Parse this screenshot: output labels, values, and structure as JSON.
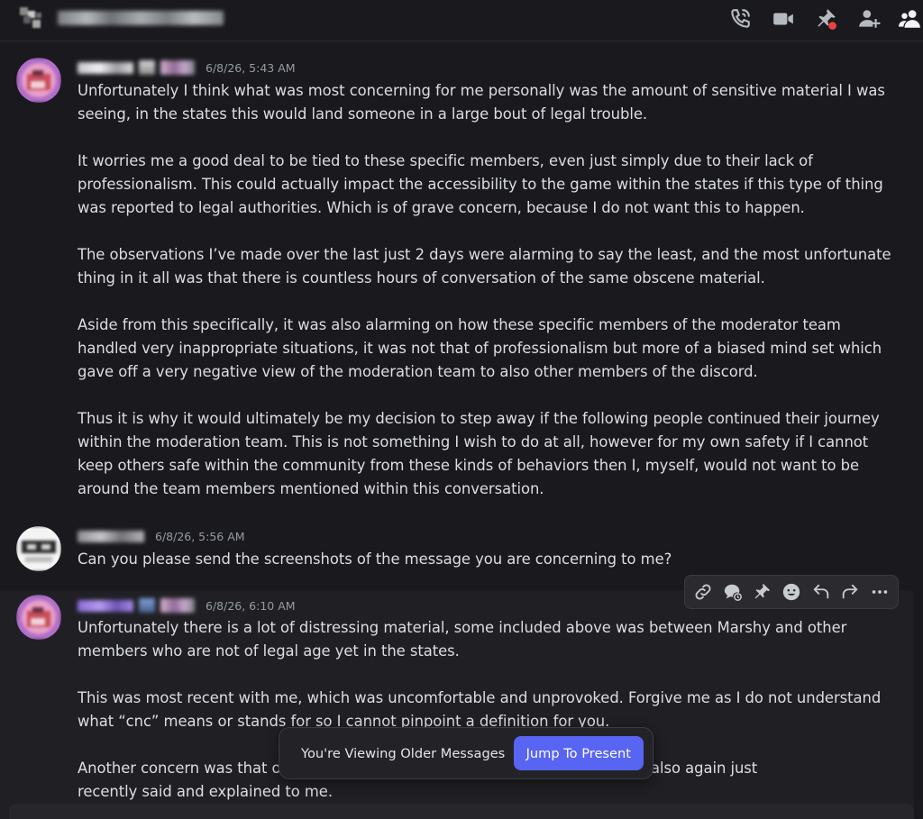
{
  "header": {
    "title": "C1Gamer, Jojiko, Salra",
    "icons": [
      "start-voice-call",
      "start-video-call",
      "pinned-messages",
      "add-friends-to-dm",
      "show-member-list"
    ],
    "alert_color": "#ed4245"
  },
  "messages": [
    {
      "author": "M1lliea",
      "timestamp": "6/8/26, 5:43 AM",
      "paragraphs": [
        "Unfortunately I think what was most concerning for me personally was the amount of sensitive material I was seeing, in the states this would land someone in a large bout of legal trouble.",
        "It worries me a good deal to be tied to these specific members, even just simply due to their lack of professionalism. This could actually impact the accessibility to the game within the states if this type of thing was reported to legal authorities. Which is of grave concern, because I do not want this to happen.",
        "The observations I’ve made over the last just 2 days were alarming to say the least, and the most unfortunate thing in it all was that there is countless hours of conversation of the same obscene material.",
        "Aside from this specifically, it was also alarming on how these specific members of the moderator team handled very inappropriate situations, it was not that of professionalism but more of a biased mind set which gave off a very negative view of the moderation team to also other members of the discord.",
        "Thus it is why it would ultimately be my decision to step away if the following people continued their journey within the moderation team. This is not something I wish to do at all, however for my own safety if I cannot keep others safe within the community from these kinds of behaviors then I, myself, would not want to be around the team members mentioned within this conversation."
      ]
    },
    {
      "author": "C1Gamer",
      "timestamp": "6/8/26, 5:56 AM",
      "paragraphs": [
        "Can you please send the screenshots of the message you are concerning to me?"
      ]
    },
    {
      "author": "M1lliea",
      "timestamp": "6/8/26, 6:10 AM",
      "paragraphs": [
        "Unfortunately there is a lot of distressing material, some included above was between Marshy and other members who are not of legal age yet in the states.",
        "This was most recent with me, which was uncomfortable and unprovoked. Forgive me as I do not understand what “cnc” means or stands for so I cannot pinpoint a definition for you.",
        "Another concern was that o",
        "as this was also again just",
        "recently said and explained to me."
      ]
    }
  ],
  "hover_toolbar": {
    "actions": [
      "copy-message-link",
      "create-thread",
      "pin-message",
      "add-reaction",
      "reply",
      "forward",
      "more"
    ]
  },
  "older_bar": {
    "label": "You're Viewing Older Messages",
    "button": "Jump To Present",
    "accent": "#5865f2"
  }
}
